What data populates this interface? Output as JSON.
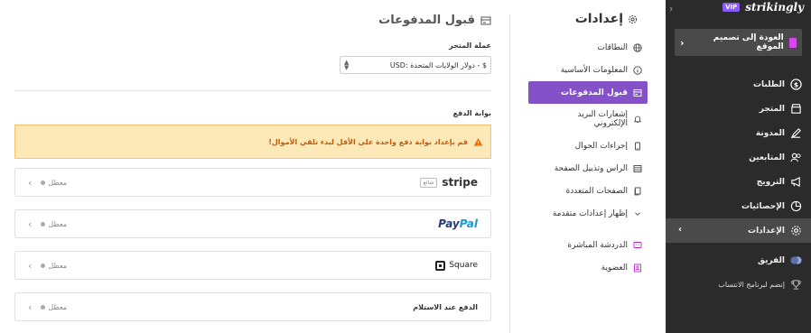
{
  "brand": {
    "name": "strikingly",
    "badge": "VIP"
  },
  "sidebar": {
    "back_label": "العودة إلى تصميم الموقع",
    "items": [
      {
        "label": "الطلبات",
        "icon": "dollar-icon"
      },
      {
        "label": "المتجر",
        "icon": "store-icon"
      },
      {
        "label": "المدونة",
        "icon": "pen-icon"
      },
      {
        "label": "المتابعين",
        "icon": "users-icon"
      },
      {
        "label": "الترويج",
        "icon": "megaphone-icon"
      },
      {
        "label": "الإحصائيات",
        "icon": "pie-chart-icon"
      },
      {
        "label": "الإعدادات",
        "icon": "gear-icon",
        "active": true
      },
      {
        "label": "الفريق",
        "icon": "team-icon"
      },
      {
        "label": "إنضم لبرنامج الانتساب",
        "icon": "trophy-icon"
      }
    ]
  },
  "settings": {
    "title": "إعدادات",
    "menu": [
      {
        "label": "النطاقات",
        "icon": "globe-icon"
      },
      {
        "label": "المعلومات الأساسية",
        "icon": "info-icon"
      },
      {
        "label": "قبول المدفوعات",
        "icon": "payment-icon",
        "active": true
      },
      {
        "label": "إشعارات البريد الإلكتروني",
        "icon": "bell-icon"
      },
      {
        "label": "إجراءات الجوال",
        "icon": "mobile-icon"
      },
      {
        "label": "الراس وتذييل الصفحة",
        "icon": "header-icon"
      },
      {
        "label": "الصفحات المتعددة",
        "icon": "pages-icon"
      },
      {
        "label": "إظهار إعدادات متقدمة",
        "icon": "chevron-down-icon"
      },
      {
        "label": "الدردشة المباشرة",
        "icon": "chat-icon"
      },
      {
        "label": "العضوية",
        "icon": "membership-icon"
      }
    ]
  },
  "main": {
    "title": "قبول المدفوعات",
    "currency_label": "عملة المتجر",
    "currency_value": "USD: دولار الولايات المتحدة - $",
    "gateway_label": "بوابة الدفع",
    "warning": "قم بإعداد بوابة دفع واحدة على الأقل لبدء تلقي الأموال!",
    "gateways": [
      {
        "name": "stripe",
        "tag": "شائع",
        "status": "معطل"
      },
      {
        "name_a": "Pay",
        "name_b": "Pal",
        "status": "معطل"
      },
      {
        "name": "Square",
        "status": "معطل"
      },
      {
        "name": "الدفع عند الاستلام",
        "status": "معطل"
      }
    ]
  },
  "colors": {
    "accent": "#8451c8",
    "warning_bg": "#fde9b8",
    "warning_text": "#c25a0a",
    "sidebar_bg": "#2b2b2b"
  }
}
